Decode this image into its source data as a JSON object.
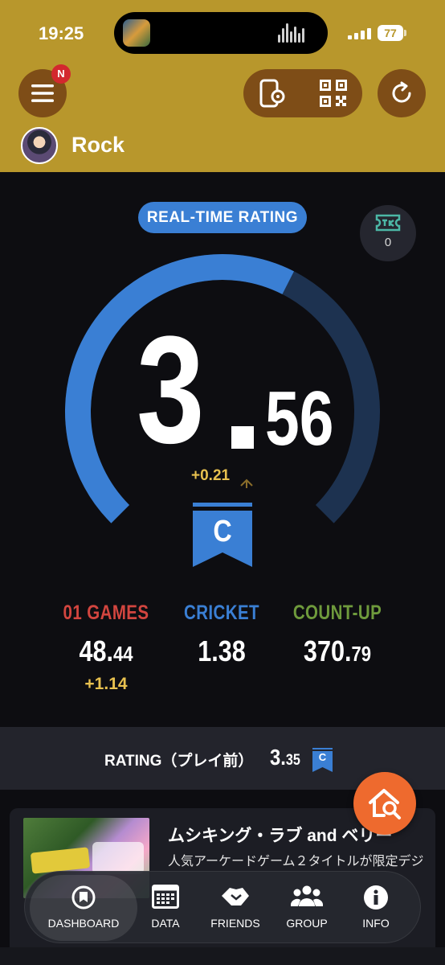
{
  "status_bar": {
    "time": "19:25",
    "battery": "77"
  },
  "header": {
    "menu_badge": "N",
    "username": "Rock",
    "icons": [
      "menu-icon",
      "device-settings-icon",
      "qr-code-icon",
      "refresh-icon"
    ]
  },
  "rating": {
    "label": "REAL-TIME RATING",
    "integer": "3",
    "decimal": "56",
    "delta": "+0.21",
    "rank": "C",
    "gauge_fraction": 0.6,
    "ticket_count": "0"
  },
  "stats": [
    {
      "label": "01 GAMES",
      "int": "48.",
      "dec": "44",
      "delta": "+1.14",
      "color": "#d2453f"
    },
    {
      "label": "CRICKET",
      "int": "1.38",
      "dec": "",
      "delta": "",
      "color": "#3a7fd4"
    },
    {
      "label": "COUNT-UP",
      "int": "370.",
      "dec": "79",
      "delta": "",
      "color": "#6e9a3c"
    }
  ],
  "previous_rating": {
    "label": "RATING（プレイ前）",
    "int": "3.",
    "dec": "35",
    "rank": "C"
  },
  "news": {
    "title": "ムシキング・ラブ and ベリー",
    "description": "人気アーケードゲーム２タイトルが限定デジ"
  },
  "tabs": [
    {
      "label": "DASHBOARD",
      "icon": "dashboard-icon"
    },
    {
      "label": "DATA",
      "icon": "calendar-icon"
    },
    {
      "label": "FRIENDS",
      "icon": "friends-icon"
    },
    {
      "label": "GROUP",
      "icon": "group-icon"
    },
    {
      "label": "INFO",
      "icon": "info-icon"
    }
  ],
  "colors": {
    "header": "#b8972c",
    "accent_blue": "#3a7fd4",
    "header_button": "#7e4d17",
    "fab": "#ee6a2e"
  }
}
